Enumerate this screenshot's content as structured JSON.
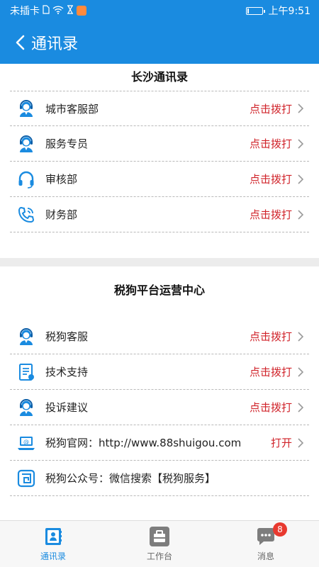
{
  "status_bar": {
    "carrier": "未插卡",
    "time": "上午9:51",
    "battery_level": 0.12,
    "icons": [
      "sim-icon",
      "wifi-icon",
      "hourglass-icon",
      "app-icon",
      "battery-icon"
    ]
  },
  "header": {
    "title": "通讯录",
    "back_icon": "back-chevron-icon"
  },
  "sections": [
    {
      "title": "长沙通讯录",
      "items": [
        {
          "label": "城市客服部",
          "action": "点击拨打",
          "icon": "service-agent-icon"
        },
        {
          "label": "服务专员",
          "action": "点击拨打",
          "icon": "service-agent-icon"
        },
        {
          "label": "审核部",
          "action": "点击拨打",
          "icon": "headphones-icon"
        },
        {
          "label": "财务部",
          "action": "点击拨打",
          "icon": "phone-call-icon"
        }
      ]
    },
    {
      "title": "税狗平台运营中心",
      "items": [
        {
          "label": "税狗客服",
          "action": "点击拨打",
          "icon": "service-agent-icon"
        },
        {
          "label": "技术支持",
          "action": "点击拨打",
          "icon": "document-icon"
        },
        {
          "label": "投诉建议",
          "action": "点击拨打",
          "icon": "service-agent-icon"
        },
        {
          "label": "税狗官网：http://www.88shuigou.com",
          "action": "打开",
          "icon": "laptop-icon"
        },
        {
          "label": "税狗公众号：微信搜索【税狗服务】",
          "action": "",
          "icon": "maze-logo-icon"
        }
      ]
    }
  ],
  "bottom_nav": {
    "items": [
      {
        "label": "通讯录",
        "active": true,
        "icon": "contacts-icon"
      },
      {
        "label": "工作台",
        "active": false,
        "icon": "workbench-icon"
      },
      {
        "label": "消息",
        "active": false,
        "icon": "message-icon",
        "badge": "8"
      }
    ]
  },
  "colors": {
    "primary": "#1a8be0",
    "action_red": "#d0232a",
    "badge_red": "#e8392f",
    "separator": "#ececec"
  }
}
